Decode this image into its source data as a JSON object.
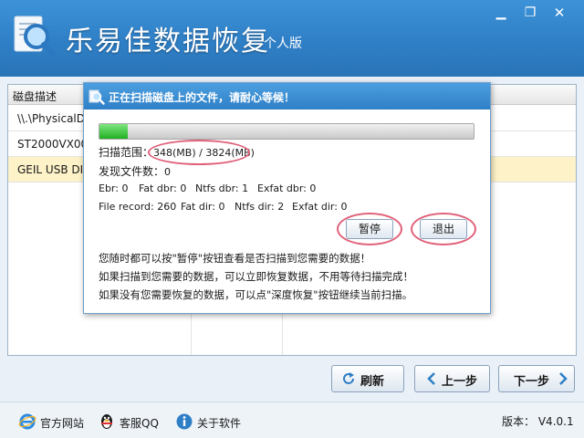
{
  "app": {
    "title": "乐易佳数据恢复",
    "edition": "个人版",
    "window_controls": {
      "minimize": "minimize-icon",
      "maximize": "restore-icon",
      "close": "close-icon"
    }
  },
  "table": {
    "header": "磁盘描述",
    "rows": [
      {
        "label": "\\\\.\\PhysicalDrive0",
        "selected": false
      },
      {
        "label": "ST2000VX000-1CU164",
        "selected": false
      },
      {
        "label": "GEIL USB DISK",
        "selected": true
      }
    ]
  },
  "dialog": {
    "title": "正在扫描磁盘上的文件，请耐心等候！",
    "progress": 0.075,
    "scan_range_label": "扫描范围：",
    "scan_range_value": "348(MB) / 3824(MB)",
    "found_files_label": "发现文件数：",
    "found_files_value": "0",
    "stats_row1": [
      "Ebr: 0",
      "Fat dbr: 0",
      "Ntfs dbr: 1",
      "Exfat dbr: 0"
    ],
    "stats_row2": [
      "File record: 260",
      "Fat dir: 0",
      "Ntfs dir: 2",
      "Exfat dir: 0"
    ],
    "pause_label": "暂停",
    "exit_label": "退出",
    "tips": [
      "您随时都可以按\"暂停\"按钮查看是否扫描到您需要的数据！",
      "如果扫描到您需要的数据，可以立即恢复数据，不用等待扫描完成！",
      "如果没有您需要恢复的数据，可以点\"深度恢复\"按钮继续当前扫描。"
    ],
    "highlight_color": "#e0607a"
  },
  "nav": {
    "refresh_label": "刷新",
    "prev_label": "上一步",
    "next_label": "下一步"
  },
  "footer": {
    "website_label": "官方网站",
    "qq_label": "客服QQ",
    "about_label": "关于软件",
    "version_label": "版本：",
    "version_value": "V4.0.1"
  },
  "colors": {
    "title_bar": "#2f7fc6",
    "selected_row": "#fdf2c8",
    "progress_fill": "#22b022"
  }
}
